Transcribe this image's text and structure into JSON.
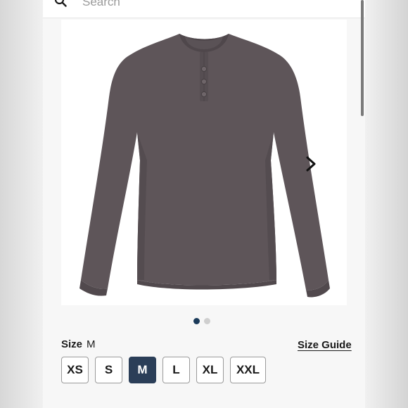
{
  "search": {
    "placeholder": "Search"
  },
  "gallery": {
    "image_description_icon": "henley-shirt-image",
    "next_icon": "chevron-right-icon",
    "dots": [
      {
        "active": true
      },
      {
        "active": false
      }
    ]
  },
  "size_selector": {
    "label": "Size",
    "selected_value": "M",
    "guide_label": "Size Guide",
    "options": [
      {
        "label": "XS",
        "selected": false
      },
      {
        "label": "S",
        "selected": false
      },
      {
        "label": "M",
        "selected": true
      },
      {
        "label": "L",
        "selected": false
      },
      {
        "label": "XL",
        "selected": false
      },
      {
        "label": "XXL",
        "selected": false
      }
    ]
  },
  "colors": {
    "accent": "#2b3e58",
    "dot_active": "#1b3b5a",
    "shirt": "#5e5559"
  }
}
